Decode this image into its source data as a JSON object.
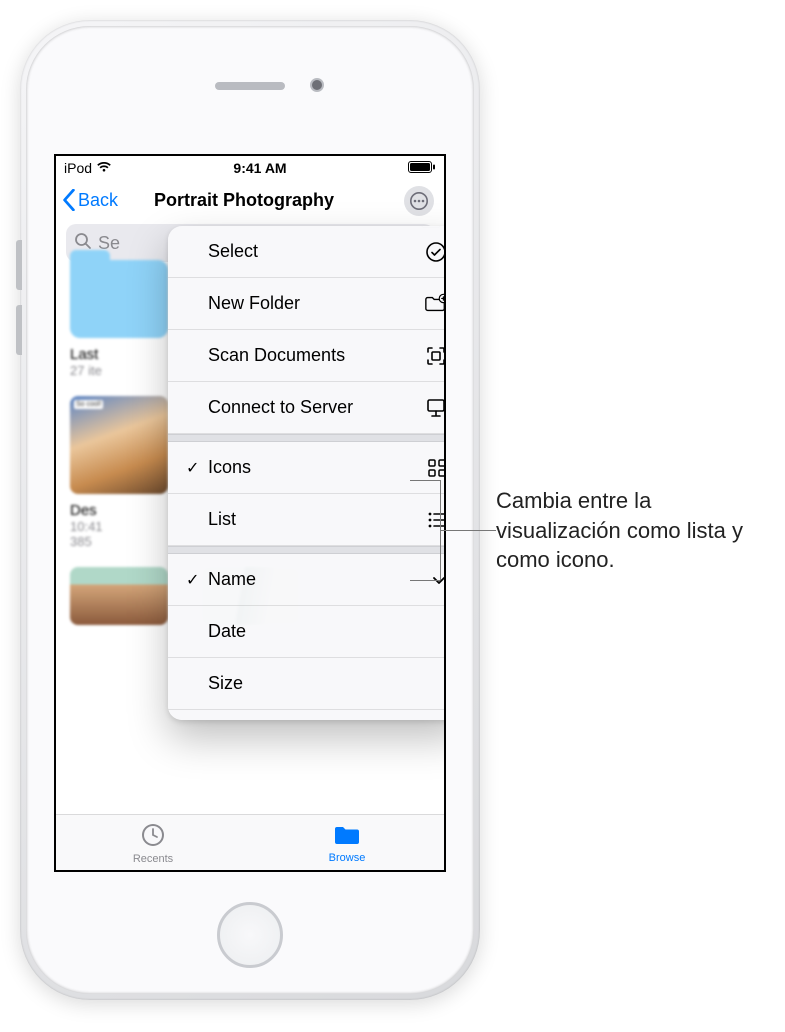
{
  "status": {
    "carrier": "iPod",
    "time": "9:41 AM"
  },
  "nav": {
    "back_label": "Back",
    "title": "Portrait Photography"
  },
  "search": {
    "placeholder": "Search",
    "visible_text": "Se"
  },
  "menu": {
    "select": "Select",
    "new_folder": "New Folder",
    "scan_documents": "Scan Documents",
    "connect_server": "Connect to Server",
    "icons": "Icons",
    "list": "List",
    "name": "Name",
    "date": "Date",
    "size": "Size",
    "checked_view": "Icons",
    "checked_sort": "Name"
  },
  "content": {
    "folder1": {
      "name": "Last",
      "sub": "27 ite"
    },
    "file1": {
      "name": "Des",
      "time": "10:41",
      "size": "385"
    }
  },
  "tabs": {
    "recents": "Recents",
    "browse": "Browse",
    "active": "Browse"
  },
  "callout": {
    "text": "Cambia entre la visualización como lista y como icono."
  }
}
